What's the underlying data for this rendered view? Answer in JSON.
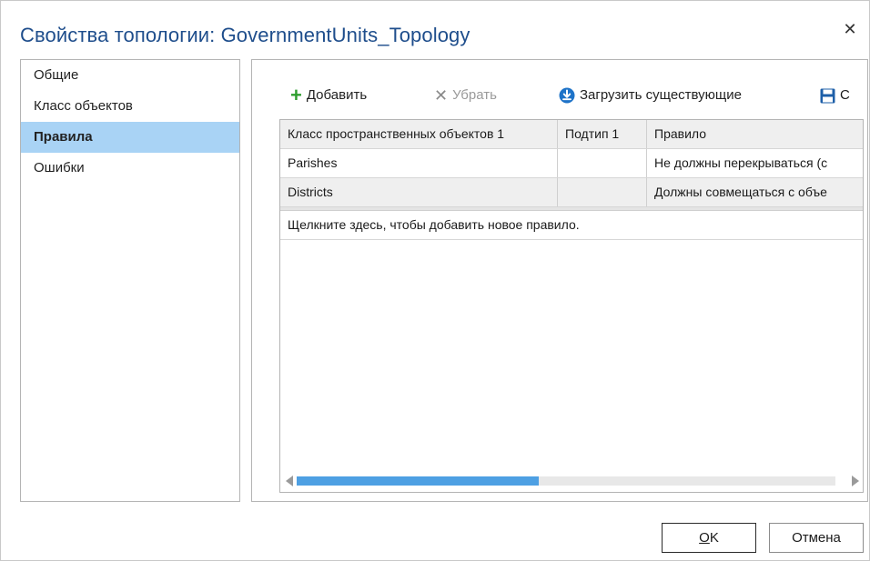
{
  "window": {
    "title": "Свойства топологии: GovernmentUnits_Topology",
    "close_glyph": "✕"
  },
  "nav": {
    "items": [
      {
        "label": "Общие",
        "selected": false
      },
      {
        "label": "Класс объектов",
        "selected": false
      },
      {
        "label": "Правила",
        "selected": true
      },
      {
        "label": "Ошибки",
        "selected": false
      }
    ]
  },
  "toolbar": {
    "add_label": "Добавить",
    "add_icon": "plus-icon",
    "remove_label": "Убрать",
    "remove_icon": "x-icon",
    "load_label": "Загрузить существующие",
    "load_icon": "download-circle-icon",
    "save_label": "С",
    "save_icon": "floppy-disk-icon"
  },
  "grid": {
    "columns": [
      "Класс пространственных объектов 1",
      "Подтип 1",
      "Правило"
    ],
    "rows": [
      [
        "Parishes",
        "",
        "Не должны перекрываться (с"
      ],
      [
        "Districts",
        "",
        "Должны совмещаться с объе"
      ]
    ],
    "new_row_hint": "Щелкните здесь, чтобы добавить новое правило.",
    "scroll_position": 0.45
  },
  "buttons": {
    "ok_mnemonic": "O",
    "ok_rest": "K",
    "cancel": "Отмена"
  },
  "colors": {
    "title": "#1f4e8c",
    "selection": "#a9d3f5",
    "add_icon": "#2e9e2e",
    "accent": "#1e73c8",
    "scroll_thumb": "#4ea0e3"
  }
}
